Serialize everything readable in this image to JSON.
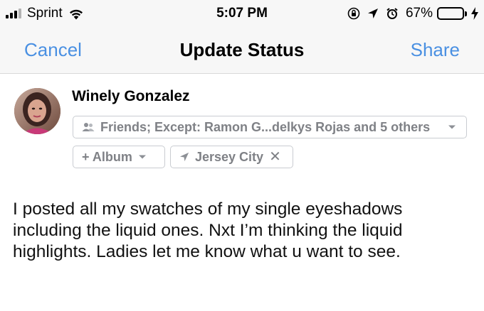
{
  "status_bar": {
    "carrier": "Sprint",
    "time": "5:07 PM",
    "battery_percent": "67%",
    "battery_level": 0.67,
    "signal_bars_active": 3,
    "signal_bars_total": 4,
    "icons": [
      "signal-icon",
      "wifi-icon",
      "orientation-lock-icon",
      "location-arrow-icon",
      "alarm-icon",
      "battery-icon",
      "charging-icon"
    ]
  },
  "nav": {
    "cancel_label": "Cancel",
    "title": "Update Status",
    "share_label": "Share",
    "accent_color": "#4a90e2"
  },
  "composer": {
    "user_name": "Winely Gonzalez",
    "audience_label": "Friends; Except: Ramon G...delkys Rojas and 5 others",
    "album_label": "+ Album",
    "location_label": "Jersey City",
    "post_text": "I posted all my swatches of my single eyeshadows including the liquid ones. Nxt I’m thinking the liquid highlights. Ladies let me know what u want to see."
  }
}
